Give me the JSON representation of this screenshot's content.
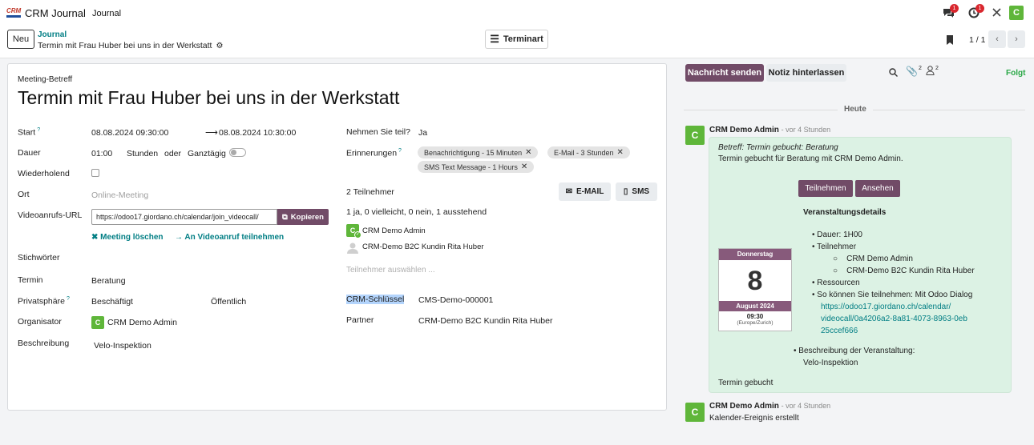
{
  "app": {
    "name": "CRM Journal",
    "logo_text": "CRM",
    "menu_journal": "Journal",
    "user_initial": "C"
  },
  "systray": {
    "messages_count": "1",
    "activities_count": "1"
  },
  "control": {
    "new_label": "Neu",
    "breadcrumb_parent": "Journal",
    "record_title": "Termin mit Frau Huber bei uns in der Werkstatt",
    "terminart_label": "Terminart",
    "pager": "1 / 1"
  },
  "form": {
    "subject_label": "Meeting-Betreff",
    "subject": "Termin mit Frau Huber bei uns in der Werkstatt",
    "start_label": "Start",
    "start_help": "?",
    "start": "08.08.2024 09:30:00",
    "stop": "08.08.2024 10:30:00",
    "duration_label": "Dauer",
    "duration": "01:00",
    "hours_label": "Stunden",
    "or_label": "oder",
    "allday_label": "Ganztägig",
    "recurrent_label": "Wiederholend",
    "location_label": "Ort",
    "location_placeholder": "Online-Meeting",
    "video_label": "Videoanrufs-URL",
    "video_url": "https://odoo17.giordano.ch/calendar/join_videocall/",
    "copy_label": "Kopieren",
    "delete_meeting": "Meeting löschen",
    "join_videocall": "An Videoanruf teilnehmen",
    "tags_label": "Stichwörter",
    "appointment_label": "Termin",
    "appointment": "Beratung",
    "privacy_label": "Privatsphäre",
    "privacy_help": "?",
    "show_as": "Beschäftigt",
    "privacy": "Öffentlich",
    "organizer_label": "Organisator",
    "organizer": "CRM Demo Admin",
    "organizer_initial": "C",
    "description_label": "Beschreibung",
    "description": "Velo-Inspektion",
    "attend_label": "Nehmen Sie teil?",
    "attend": "Ja",
    "reminders_label": "Erinnerungen",
    "reminders_help": "?",
    "reminders": [
      "Benachrichtigung - 15 Minuten",
      "E-Mail - 3 Stunden",
      "SMS Text Message - 1 Hours"
    ],
    "attendees_count": "2 Teilnehmer",
    "email_btn": "E-MAIL",
    "sms_btn": "SMS",
    "attendee_summary": "1 ja, 0 vielleicht, 0 nein, 1 ausstehend",
    "attendees": [
      "CRM Demo Admin",
      "CRM-Demo B2C Kundin Rita Huber"
    ],
    "attendee_initial": "C",
    "select_attendees_placeholder": "Teilnehmer auswählen ...",
    "crm_key_label": "CRM-Schlüssel",
    "crm_key": "CMS-Demo-000001",
    "partner_label": "Partner",
    "partner": "CRM-Demo B2C Kundin Rita Huber"
  },
  "chatter": {
    "send_message": "Nachricht senden",
    "log_note": "Notiz hinterlassen",
    "attachments_count": "2",
    "followers_count": "2",
    "follow_status": "Folgt",
    "date_separator": "Heute",
    "messages": [
      {
        "author": "CRM Demo Admin",
        "time": "- vor 4 Stunden",
        "initial": "C",
        "subject": "Betreff: Termin gebucht: Beratung",
        "body": "Termin gebucht für Beratung mit CRM Demo Admin.",
        "btn_attendees": "Teilnehmen",
        "btn_view": "Ansehen",
        "details_title": "Veranstaltungsdetails",
        "duration": "Dauer: 1H00",
        "attendees_title": "Teilnehmer",
        "attendees": [
          "CRM Demo Admin",
          "CRM-Demo B2C Kundin Rita Huber"
        ],
        "resources": "Ressourcen",
        "join_text": "So können Sie teilnehmen: Mit Odoo Dialog",
        "join_url_1": "https://odoo17.giordano.ch/calendar/",
        "join_url_2": "videocall/0a4206a2-8a81-4073-8963-0eb",
        "join_url_3": "25ccef666",
        "desc_title": "Beschreibung der Veranstaltung:",
        "desc": "Velo-Inspektion",
        "footer": "Termin gebucht",
        "cal_day": "Donnerstag",
        "cal_date": "8",
        "cal_month": "August 2024",
        "cal_time": "09:30",
        "cal_tz": "(Europe/Zurich)"
      },
      {
        "author": "CRM Demo Admin",
        "time": "- vor 4 Stunden",
        "initial": "C",
        "body": "Kalender-Ereignis erstellt"
      }
    ]
  },
  "colors": {
    "brand": "#714b67",
    "accent": "#017e84",
    "avatar": "#5fb63a",
    "message_bg": "#dcf2e4"
  }
}
